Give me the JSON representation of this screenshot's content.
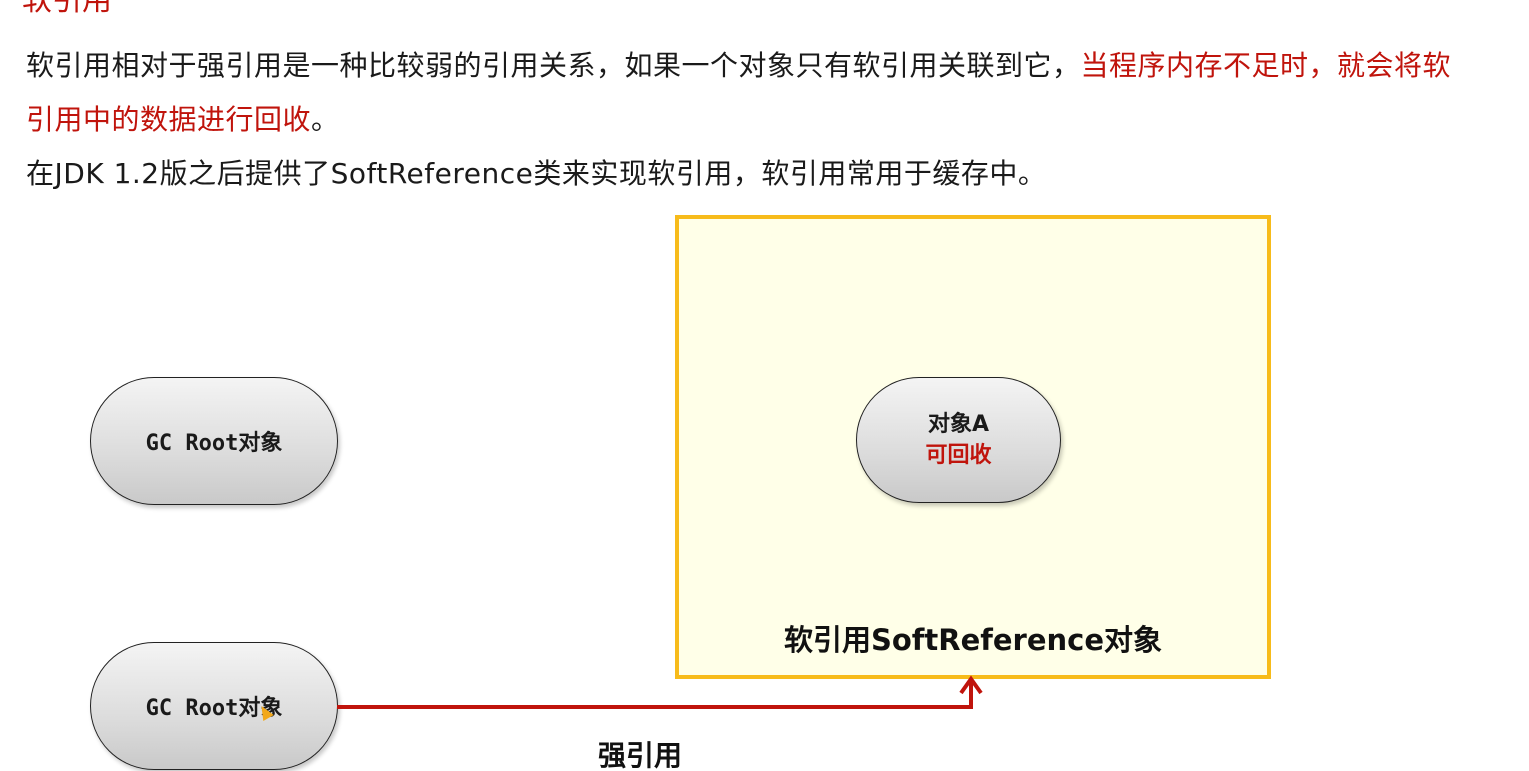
{
  "heading": "软引用",
  "paragraph1_normal": "软引用相对于强引用是一种比较弱的引用关系，如果一个对象只有软引用关联到它，",
  "paragraph1_red": "当程序内存不足时，就会将软",
  "paragraph2_red": "引用中的数据进行回收",
  "paragraph2_end": "。",
  "paragraph3": "在JDK 1.2版之后提供了SoftReference类来实现软引用，软引用常用于缓存中。",
  "diagram": {
    "gc_root_top": {
      "mono": "GC Root",
      "cjk": "对象"
    },
    "gc_root_bottom": {
      "mono": "GC Root",
      "cjk": "对象"
    },
    "object_a": {
      "name": "对象A",
      "status": "可回收"
    },
    "soft_reference_box": {
      "label": "软引用SoftReference对象"
    },
    "edge_label": "强引用"
  },
  "colors": {
    "accent_red": "#c0140c",
    "box_border": "#f7bb1a",
    "box_fill": "#ffffe8",
    "arrow": "#c0140c"
  }
}
